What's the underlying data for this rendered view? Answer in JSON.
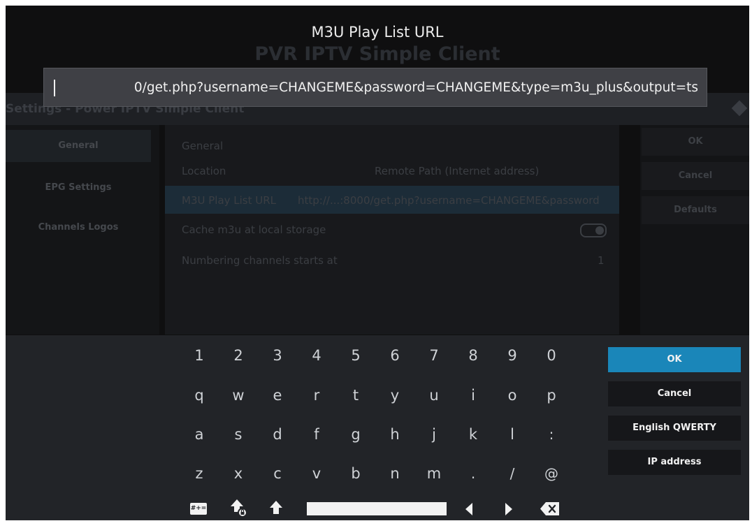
{
  "background": {
    "header_title": "Settings - Power IPTV Simple Client",
    "addon_title": "PVR IPTV Simple Client",
    "sidebar": [
      "General",
      "EPG Settings",
      "Channels Logos"
    ],
    "section_label": "General",
    "rows": [
      {
        "label": "Location",
        "value": "Remote Path (Internet address)"
      },
      {
        "label": "M3U Play List URL",
        "value": "http://...:8000/get.php?username=CHANGEME&password"
      },
      {
        "label": "Cache m3u at local storage",
        "value": ""
      },
      {
        "label": "Numbering channels starts at",
        "value": "1"
      }
    ],
    "actions": [
      "OK",
      "Cancel",
      "Defaults"
    ]
  },
  "dialog": {
    "heading": "M3U Play List URL",
    "input_value": "0/get.php?username=CHANGEME&password=CHANGEME&type=m3u_plus&output=ts"
  },
  "keyboard": {
    "rows": [
      [
        "1",
        "2",
        "3",
        "4",
        "5",
        "6",
        "7",
        "8",
        "9",
        "0"
      ],
      [
        "q",
        "w",
        "e",
        "r",
        "t",
        "y",
        "u",
        "i",
        "o",
        "p"
      ],
      [
        "a",
        "s",
        "d",
        "f",
        "g",
        "h",
        "j",
        "k",
        "l",
        ":"
      ],
      [
        "z",
        "x",
        "c",
        "v",
        "b",
        "n",
        "m",
        ".",
        "/",
        "@"
      ]
    ],
    "symbols_label": "#+=",
    "side_buttons": [
      "OK",
      "Cancel",
      "English QWERTY",
      "IP address"
    ],
    "icons": [
      "symbols-key-icon",
      "shift-lock-icon",
      "shift-icon",
      "space-bar",
      "arrow-left-icon",
      "arrow-right-icon",
      "backspace-icon"
    ]
  },
  "colors": {
    "focus": "#1a86b9",
    "panel": "#222428",
    "input": "#3f4045"
  }
}
